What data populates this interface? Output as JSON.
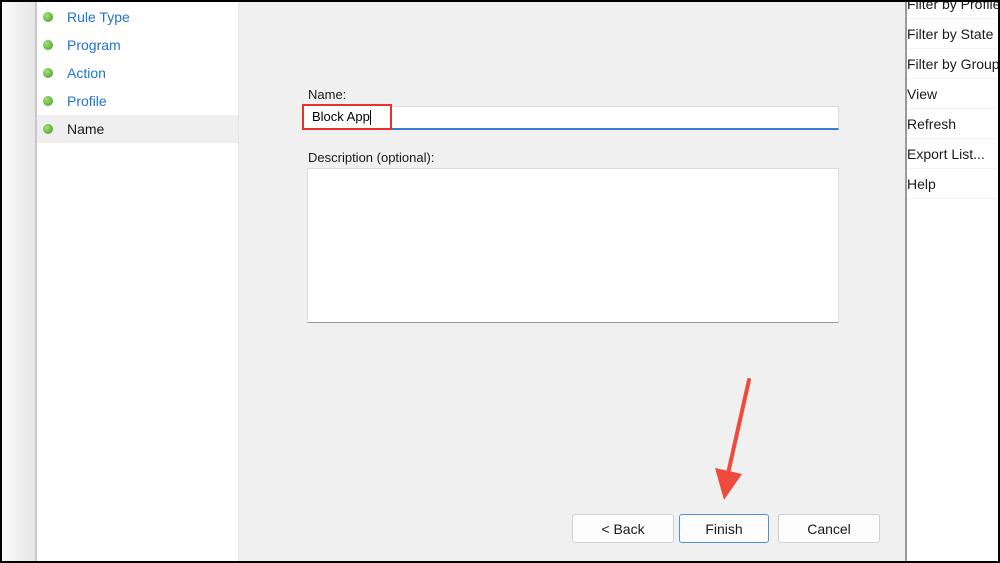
{
  "steps": [
    {
      "label": "Rule Type",
      "state": "done"
    },
    {
      "label": "Program",
      "state": "done"
    },
    {
      "label": "Action",
      "state": "done"
    },
    {
      "label": "Profile",
      "state": "done"
    },
    {
      "label": "Name",
      "state": "current"
    }
  ],
  "form": {
    "name_label": "Name:",
    "name_value": "Block App",
    "description_label": "Description (optional):",
    "description_value": ""
  },
  "buttons": {
    "back": "< Back",
    "finish": "Finish",
    "cancel": "Cancel"
  },
  "actions_pane": [
    "Filter by Profile",
    "Filter by State",
    "Filter by Group",
    "View",
    "Refresh",
    "Export List...",
    "Help"
  ],
  "colors": {
    "highlight_box": "#e8312f",
    "annotation_arrow": "#f04a3e",
    "link": "#1e73d4"
  }
}
